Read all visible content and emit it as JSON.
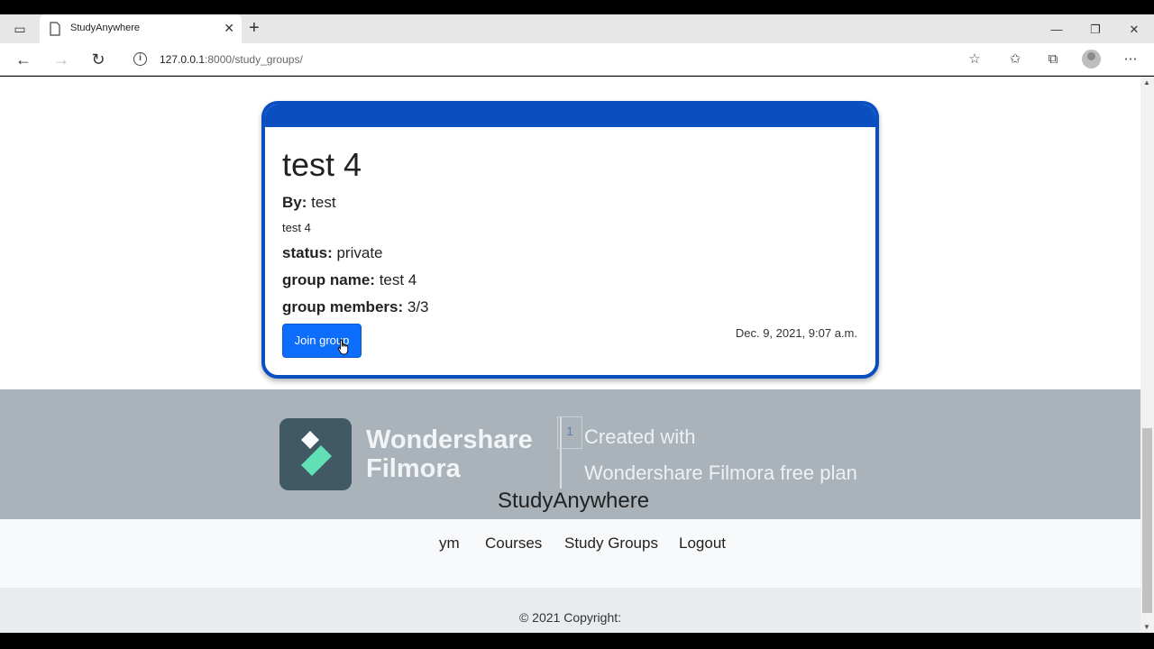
{
  "browser": {
    "tab_title": "StudyAnywhere",
    "url_host": "127.0.0.1",
    "url_rest": ":8000/study_groups/"
  },
  "card": {
    "title": "test 4",
    "by_label": "By:",
    "by_value": "test",
    "description": "test 4",
    "status_label": "status:",
    "status_value": "private",
    "group_name_label": "group name:",
    "group_name_value": "test 4",
    "members_label": "group members:",
    "members_value": "3/3",
    "join_button": "Join group",
    "date": "Dec. 9, 2021, 9:07 a.m."
  },
  "watermark": {
    "brand_line1": "Wondershare",
    "brand_line2": "Filmora",
    "badge": "1",
    "line1": "Created with",
    "line2": "Wondershare Filmora free plan"
  },
  "footer": {
    "brand": "StudyAnywhere",
    "nav": [
      "ym",
      "Courses",
      "Study Groups",
      "Logout"
    ],
    "copyright": "© 2021 Copyright:"
  },
  "colors": {
    "accent": "#0a4fc0",
    "button": "#0d6efd"
  }
}
